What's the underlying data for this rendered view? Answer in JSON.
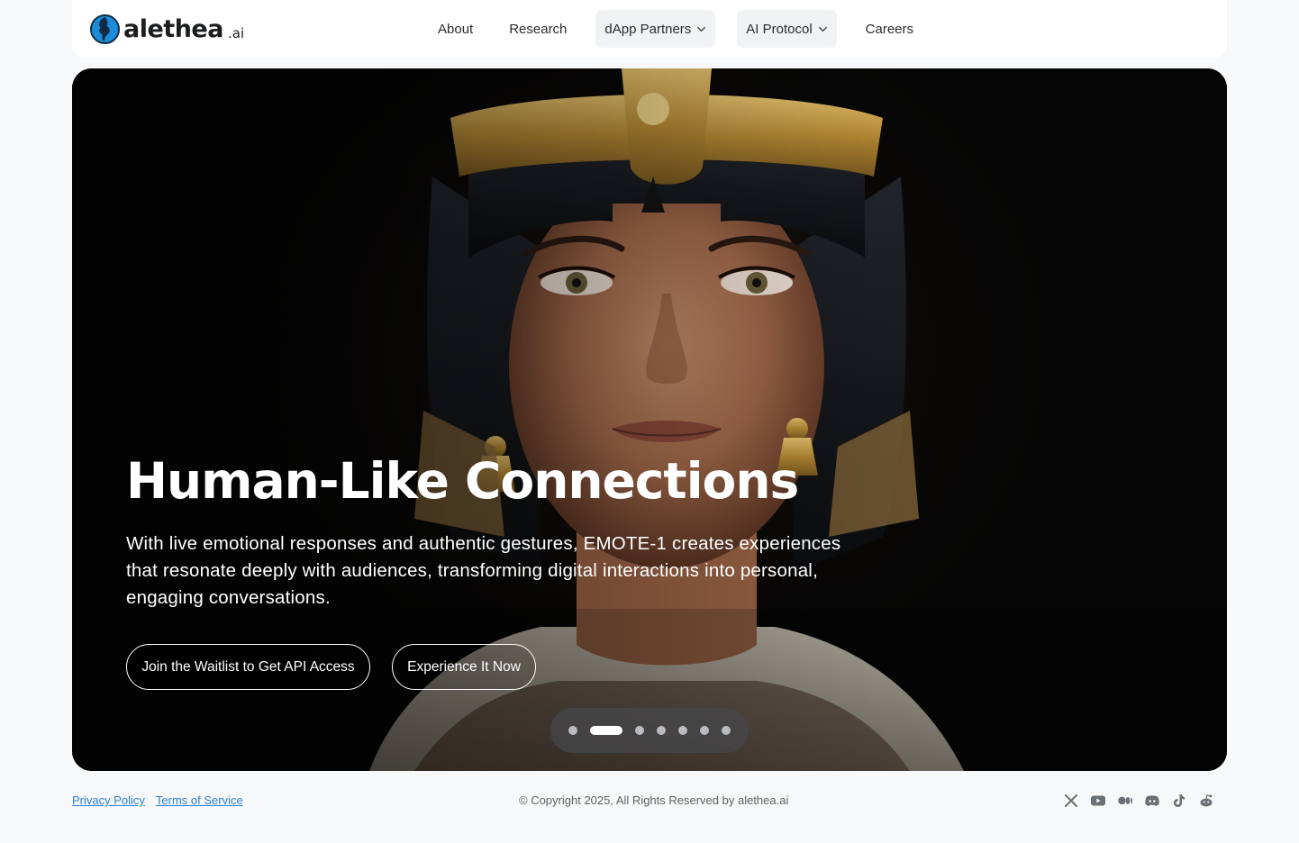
{
  "header": {
    "logo": {
      "word": "alethea",
      "suffix": ".ai"
    },
    "nav": [
      {
        "label": "About",
        "dropdown": false
      },
      {
        "label": "Research",
        "dropdown": false
      },
      {
        "label": "dApp Partners",
        "dropdown": true
      },
      {
        "label": "AI Protocol",
        "dropdown": true
      },
      {
        "label": "Careers",
        "dropdown": false
      }
    ]
  },
  "hero": {
    "title": "Human-Like Connections",
    "description": "With live emotional responses and authentic gestures, EMOTE-1 creates experiences that resonate deeply with audiences, transforming digital interactions into personal, engaging conversations.",
    "primary_cta": "Join the Waitlist to Get API Access",
    "secondary_cta": "Experience It Now",
    "carousel": {
      "slide_count": 7,
      "active_index": 1
    }
  },
  "footer": {
    "links": [
      "Privacy Policy",
      "Terms of Service"
    ],
    "copyright": "© Copyright 2025, All Rights Reserved by alethea.ai",
    "socials": [
      "x-icon",
      "youtube-icon",
      "medium-icon",
      "discord-icon",
      "tiktok-icon",
      "reddit-icon"
    ]
  },
  "colors": {
    "page_bg": "#f7f8f9",
    "link": "#2a7fd4",
    "logo_blue": "#1a8cd8"
  }
}
